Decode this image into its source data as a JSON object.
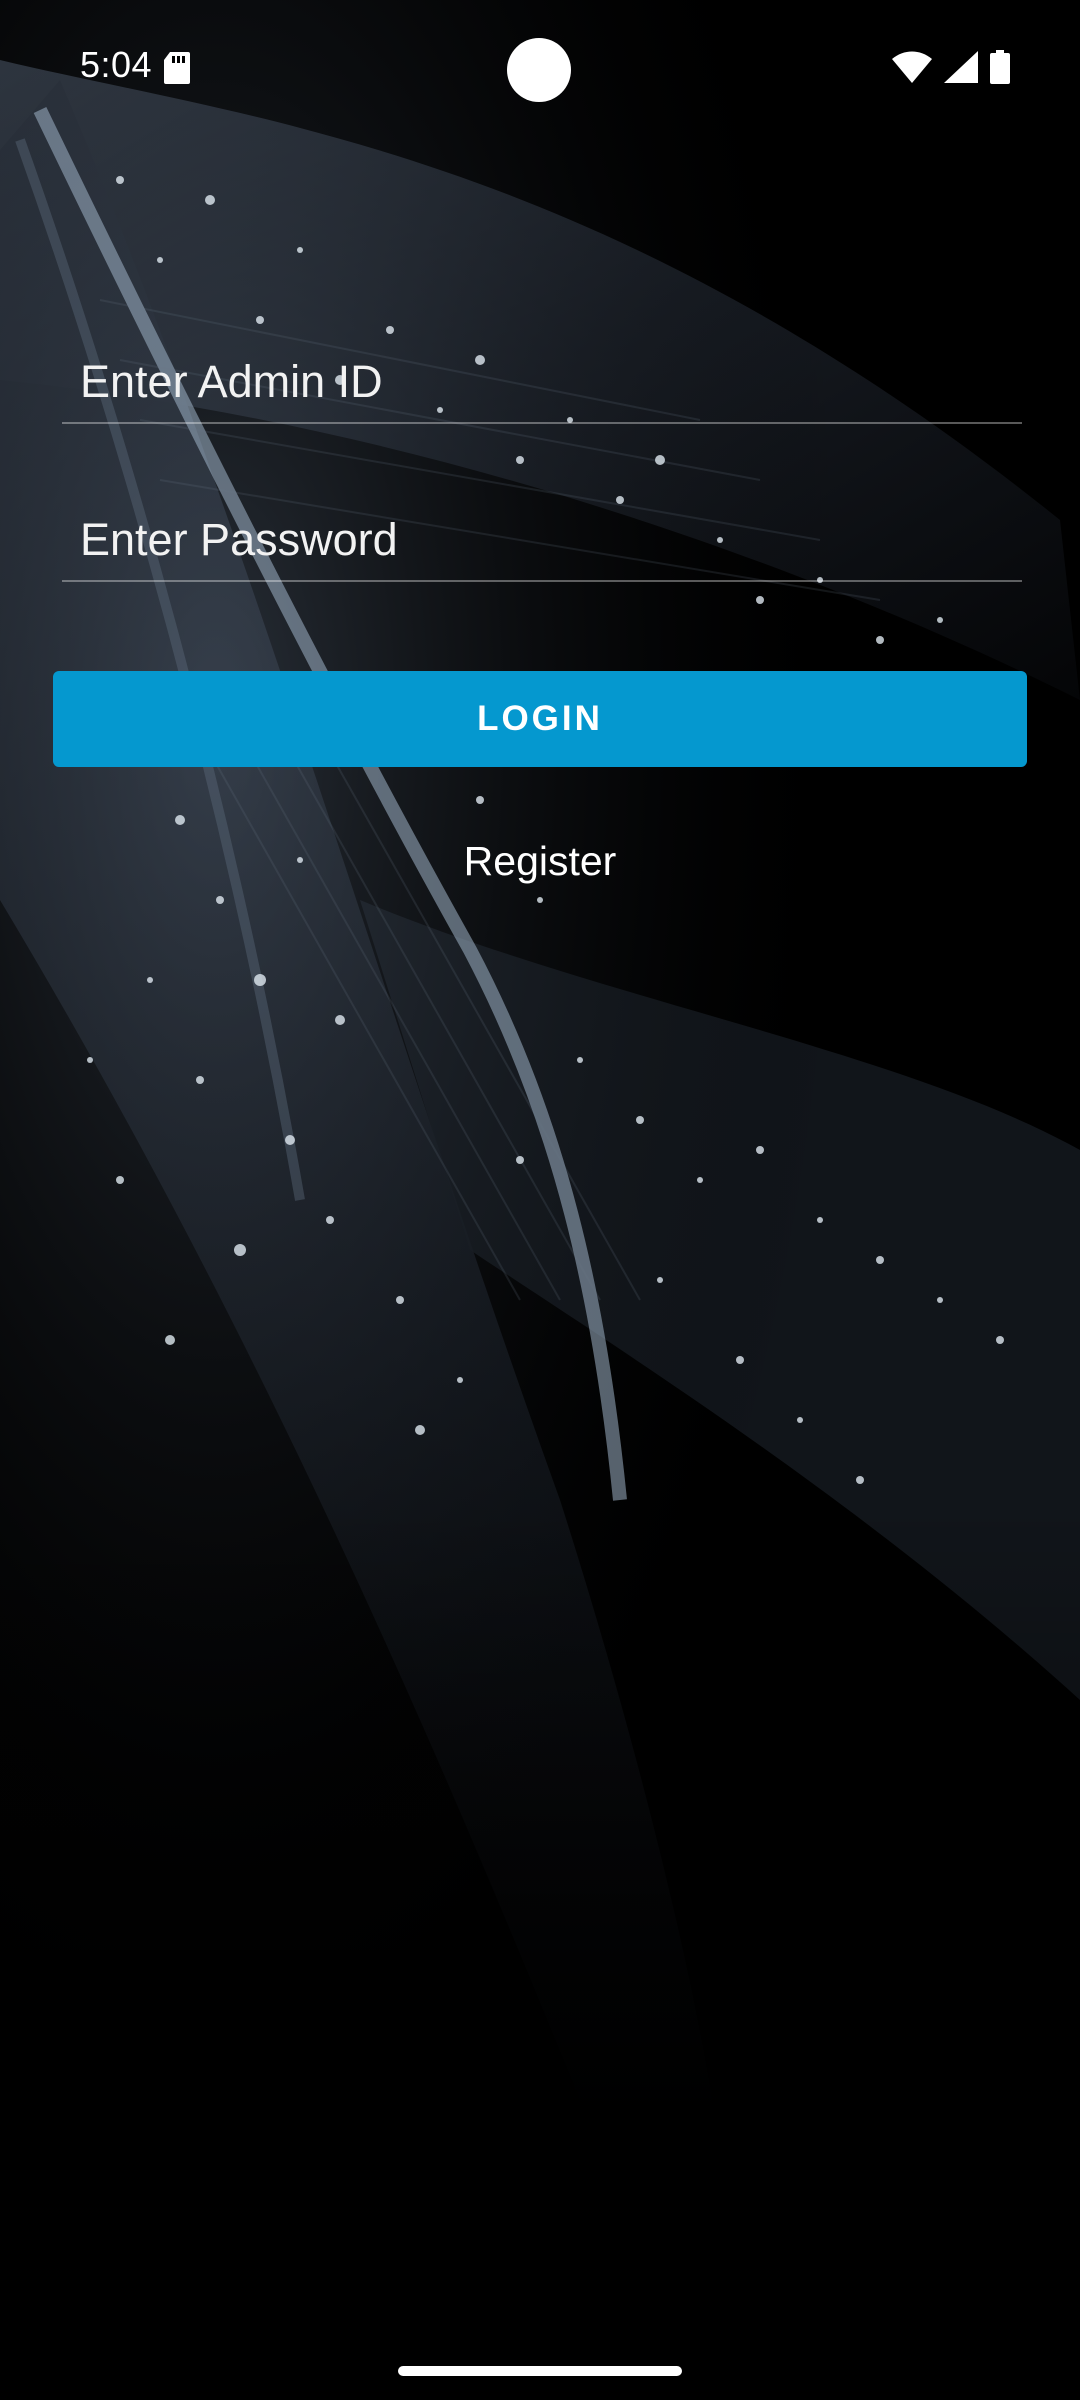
{
  "status_bar": {
    "time": "5:04",
    "icons": [
      "sd-card-icon",
      "wifi-icon",
      "cellular-signal-icon",
      "battery-icon"
    ]
  },
  "form": {
    "admin_id_placeholder": "Enter Admin ID",
    "admin_id_value": "",
    "password_placeholder": "Enter Password",
    "password_value": "",
    "login_label": "LOGIN",
    "register_label": "Register"
  },
  "colors": {
    "accent": "#0598cf",
    "background": "#000000",
    "text": "#ffffff"
  }
}
